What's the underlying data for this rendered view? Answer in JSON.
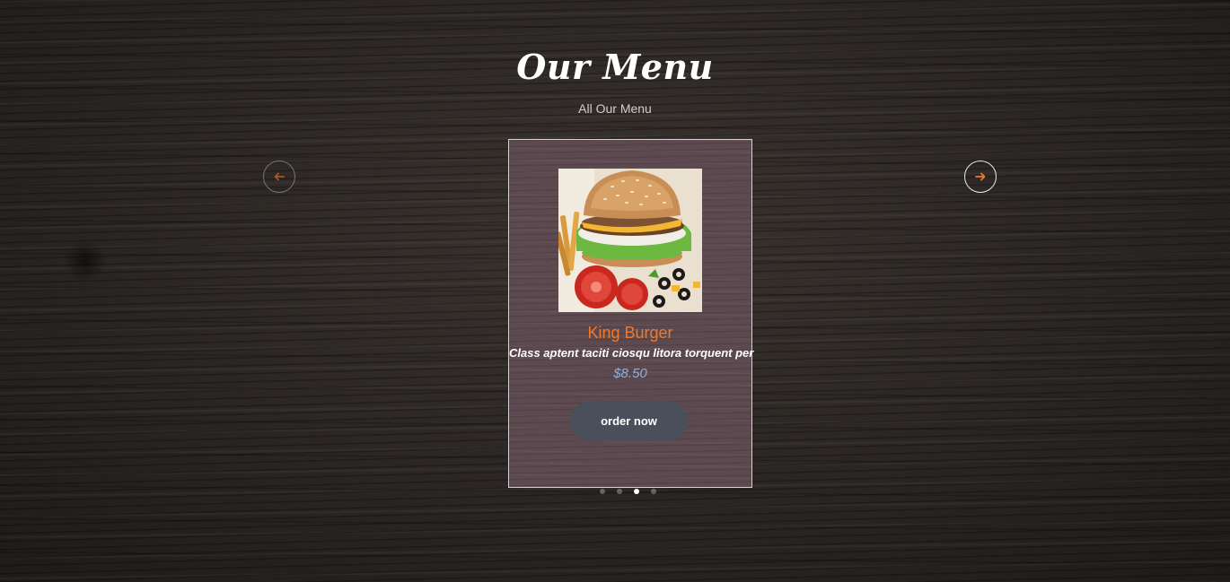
{
  "section": {
    "title": "Our Menu",
    "subtitle": "All Our Menu"
  },
  "carousel": {
    "prev_icon": "arrow-left-icon",
    "next_icon": "arrow-right-icon",
    "accent_color": "#f07a2e",
    "active_index": 2,
    "dot_count": 4
  },
  "card": {
    "image": "burger-photo",
    "name": "King Burger",
    "description": "Class aptent taciti ciosqu litora torquent per",
    "price": "$8.50",
    "button_label": "order now",
    "name_color": "#f07a2e",
    "price_color": "#8db0e0"
  }
}
